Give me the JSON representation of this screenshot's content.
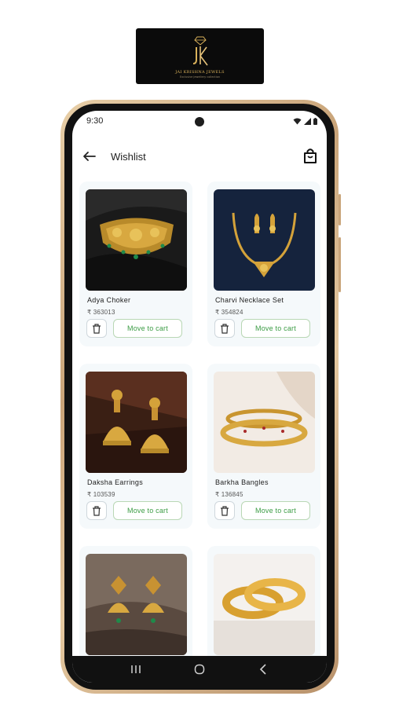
{
  "brand": {
    "name": "JAI KRISHNA JEWELS",
    "tagline": "Exclusive jewellery collection",
    "logo_icon": "jk-monogram-diamond-icon",
    "accent": "#d9b15a"
  },
  "status_bar": {
    "time": "9:30",
    "icons": [
      "wifi-icon",
      "signal-icon",
      "battery-icon"
    ]
  },
  "app_bar": {
    "title": "Wishlist",
    "back_icon": "arrow-left-icon",
    "cart_icon": "shopping-bag-icon"
  },
  "wishlist": {
    "items": [
      {
        "name": "Adya Choker",
        "price": "₹ 363013",
        "image": "gold-choker-necklace",
        "action": "Move to cart"
      },
      {
        "name": "Charvi Necklace Set",
        "price": "₹ 354824",
        "image": "gold-necklace-set-with-earrings",
        "action": "Move to cart"
      },
      {
        "name": "Daksha Earrings",
        "price": "₹ 103539",
        "image": "gold-jhumka-earrings",
        "action": "Move to cart"
      },
      {
        "name": "Barkha Bangles",
        "price": "₹ 136845",
        "image": "gold-bangles-pair",
        "action": "Move to cart"
      },
      {
        "name": "",
        "price": "",
        "image": "gold-temple-earrings",
        "action": ""
      },
      {
        "name": "",
        "price": "",
        "image": "gold-bangles-stack",
        "action": ""
      }
    ]
  },
  "nav": {
    "recents_icon": "recents-icon",
    "home_icon": "home-circle-icon",
    "back_icon": "nav-back-icon"
  },
  "colors": {
    "action_green": "#3b9c44",
    "card_bg": "#f5f9fb",
    "phone_gold": "#c9a479"
  }
}
